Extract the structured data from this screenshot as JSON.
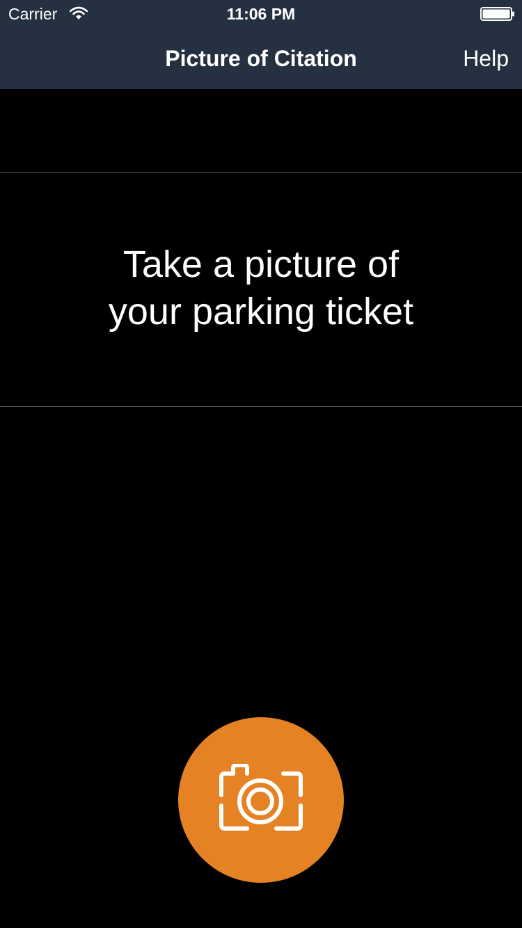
{
  "status_bar": {
    "carrier": "Carrier",
    "time": "11:06 PM",
    "wifi_icon": "wifi-icon",
    "battery_icon": "battery-icon"
  },
  "nav": {
    "title": "Picture of Citation",
    "help_label": "Help"
  },
  "instruction": {
    "line1": "Take a picture of",
    "line2": "your parking ticket"
  },
  "capture": {
    "icon": "camera-icon",
    "color": "#e58224"
  },
  "colors": {
    "nav_background": "#253140",
    "background": "#000000",
    "text": "#ffffff",
    "accent": "#e58224"
  }
}
